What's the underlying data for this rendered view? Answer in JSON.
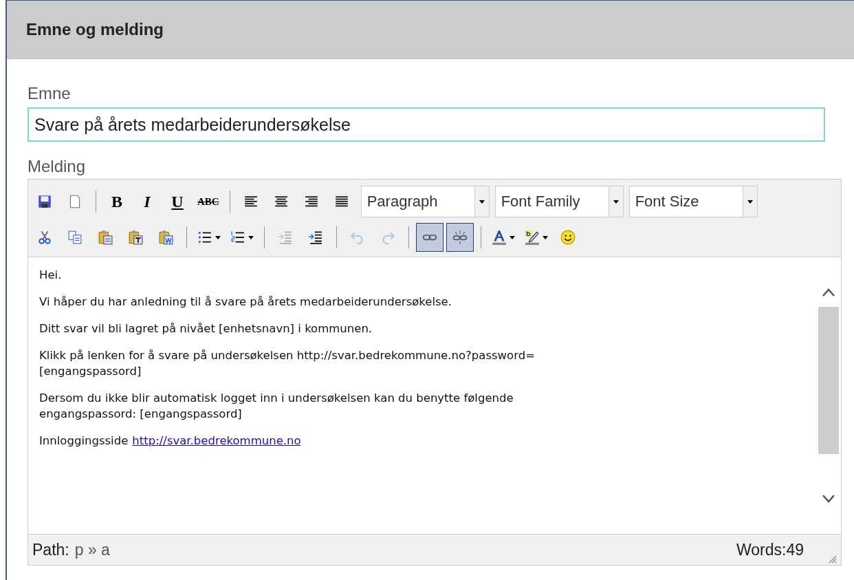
{
  "panel": {
    "title": "Emne og melding"
  },
  "subject": {
    "label": "Emne",
    "value": "Svare på årets medarbeiderundersøkelse"
  },
  "message": {
    "label": "Melding"
  },
  "toolbar_rows": [
    [
      {
        "kind": "icon",
        "disabled": false,
        "selected": false,
        "split": false
      },
      {
        "kind": "icon",
        "disabled": false,
        "selected": false,
        "split": false
      },
      {
        "kind": "separator"
      },
      {
        "kind": "glyph",
        "label": "B"
      },
      {
        "kind": "glyph",
        "label": "I"
      },
      {
        "kind": "glyph",
        "label": "U"
      },
      {
        "kind": "glyph",
        "label": "ABC"
      },
      {
        "kind": "separator"
      },
      {
        "kind": "icon",
        "disabled": false,
        "selected": false,
        "split": false
      },
      {
        "kind": "icon",
        "disabled": false,
        "selected": false,
        "split": false
      },
      {
        "kind": "icon",
        "disabled": false,
        "selected": false,
        "split": false
      },
      {
        "kind": "icon",
        "disabled": false,
        "selected": false,
        "split": false
      },
      {
        "kind": "select",
        "label": "Paragraph"
      },
      {
        "kind": "select",
        "label": "Font Family"
      },
      {
        "kind": "select",
        "label": "Font Size"
      }
    ],
    [
      {
        "kind": "icon",
        "disabled": false,
        "selected": false,
        "split": false
      },
      {
        "kind": "icon",
        "disabled": false,
        "selected": false,
        "split": false
      },
      {
        "kind": "icon",
        "disabled": false,
        "selected": false,
        "split": false
      },
      {
        "kind": "icon",
        "disabled": false,
        "selected": false,
        "split": false
      },
      {
        "kind": "icon",
        "disabled": false,
        "selected": false,
        "split": false
      },
      {
        "kind": "separator"
      },
      {
        "kind": "icon",
        "disabled": false,
        "selected": false,
        "split": true
      },
      {
        "kind": "icon",
        "disabled": false,
        "selected": false,
        "split": true
      },
      {
        "kind": "separator"
      },
      {
        "kind": "icon",
        "disabled": true,
        "selected": false,
        "split": false
      },
      {
        "kind": "icon",
        "disabled": false,
        "selected": false,
        "split": false
      },
      {
        "kind": "separator"
      },
      {
        "kind": "icon",
        "disabled": true,
        "selected": false,
        "split": false
      },
      {
        "kind": "icon",
        "disabled": true,
        "selected": false,
        "split": false
      },
      {
        "kind": "separator"
      },
      {
        "kind": "icon",
        "disabled": false,
        "selected": true,
        "split": false
      },
      {
        "kind": "icon",
        "disabled": false,
        "selected": true,
        "split": false
      },
      {
        "kind": "separator"
      },
      {
        "kind": "icon",
        "disabled": false,
        "selected": false,
        "split": true
      },
      {
        "kind": "icon",
        "disabled": false,
        "selected": false,
        "split": true
      },
      {
        "kind": "icon",
        "disabled": false,
        "selected": false,
        "split": false
      }
    ]
  ],
  "paragraphs": [
    {
      "lines": [
        "Hei."
      ]
    },
    {
      "lines": [
        "Vi håper du har anledning til å svare på årets medarbeiderundersøkelse."
      ]
    },
    {
      "lines": [
        "Ditt svar vil bli lagret på nivået [enhetsnavn] i kommunen."
      ]
    },
    {
      "lines": [
        "Klikk på lenken for å svare på undersøkelsen http://svar.bedrekommune.no?password=",
        "[engangspassord]"
      ]
    },
    {
      "lines": [
        "Dersom du ikke blir automatisk logget inn i undersøkelsen kan du benytte følgende",
        "engangspassord: [engangspassord]"
      ]
    },
    {
      "lines": [
        "Innloggingsside"
      ],
      "link": "http://svar.bedrekommune.no"
    }
  ],
  "status_bar": {
    "path_label": "Path:",
    "path": "p » a",
    "words": "Words:49"
  }
}
